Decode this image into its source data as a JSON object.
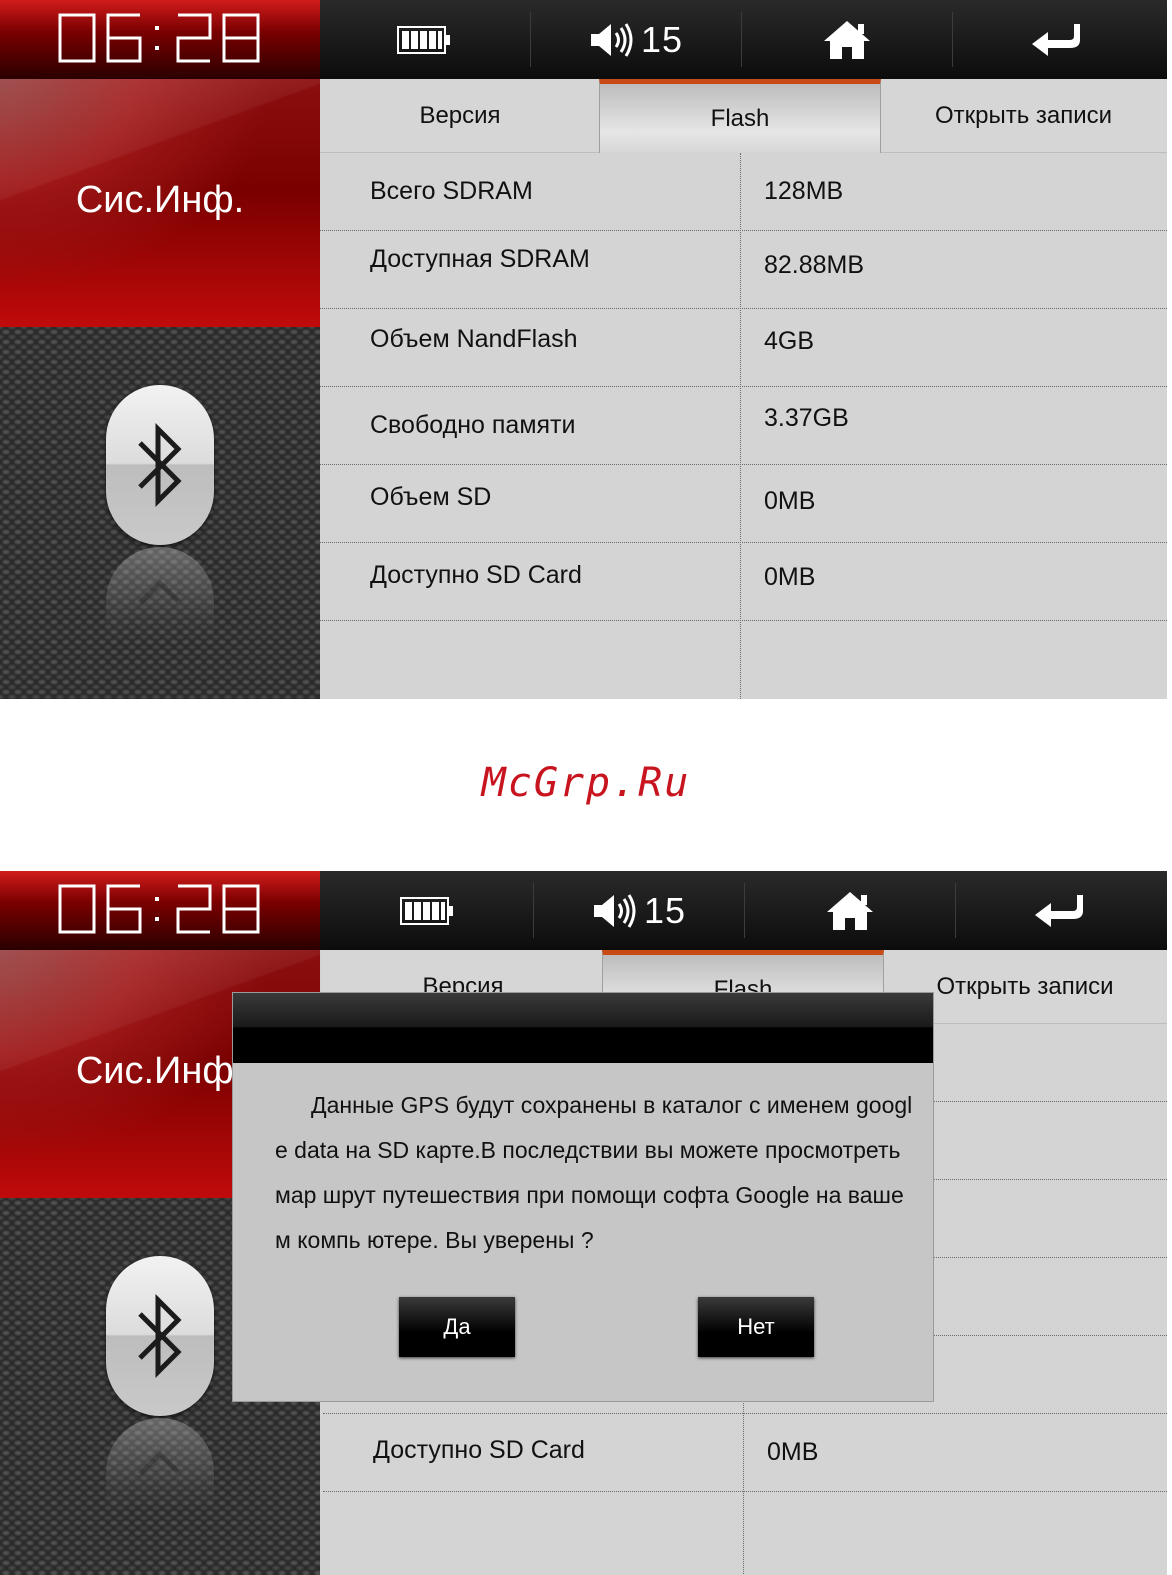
{
  "status_bar": {
    "time": "06:28",
    "volume_level": "15",
    "icons": [
      "battery-icon",
      "volume-icon",
      "home-icon",
      "back-icon"
    ]
  },
  "sidebar": {
    "title": "Сис.Инф.",
    "icon": "bluetooth-icon"
  },
  "tabs": [
    {
      "label": "Версия",
      "active": false
    },
    {
      "label": "Flash",
      "active": true
    },
    {
      "label": "Открыть записи",
      "active": false
    }
  ],
  "info_rows": [
    {
      "label": "Всего SDRAM",
      "value": "128MB"
    },
    {
      "label": "Доступная SDRAM",
      "value": "82.88MB"
    },
    {
      "label": "Объем NandFlash",
      "value": "4GB"
    },
    {
      "label": "Свободно памяти",
      "value": "3.37GB"
    },
    {
      "label": "Объем SD",
      "value": "0MB"
    },
    {
      "label": "Доступно SD Card",
      "value": "0MB"
    }
  ],
  "watermark": "McGrp.Ru",
  "dialog": {
    "message": "Данные GPS будут сохранены в каталог с именем google data на SD карте.В последствии вы можете просмотреть мар шрут путешествия при помощи софта Google на вашем компь ютере. Вы уверены ?",
    "confirm_label": "Да",
    "cancel_label": "Нет"
  },
  "colors": {
    "accent_red": "#c00a0a",
    "active_tab_border": "#c84a14",
    "watermark": "#c8141e"
  }
}
